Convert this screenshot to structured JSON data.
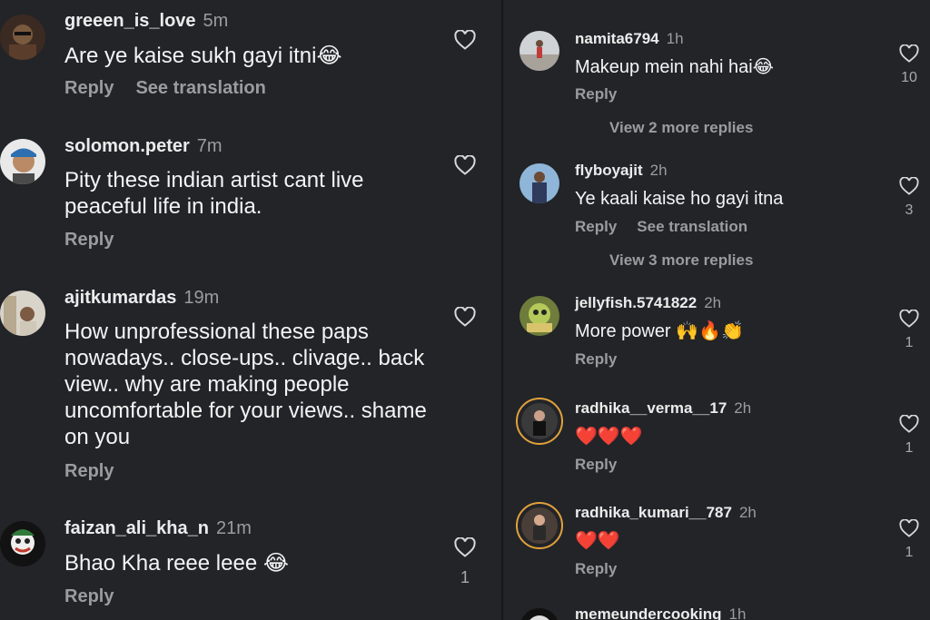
{
  "left_comments": [
    {
      "username": "greeen_is_love",
      "time": "5m",
      "text": "Are ye kaise sukh gayi itni😂",
      "reply": "Reply",
      "translate": "See translation",
      "likes": ""
    },
    {
      "username": "solomon.peter",
      "time": "7m",
      "text": "Pity these indian artist cant live peaceful life in india.",
      "reply": "Reply",
      "translate": "",
      "likes": ""
    },
    {
      "username": "ajitkumardas",
      "time": "19m",
      "text": "How unprofessional these paps nowadays.. close-ups.. clivage.. back view.. why are making people uncomfortable for your views.. shame on you",
      "reply": "Reply",
      "translate": "",
      "likes": ""
    },
    {
      "username": "faizan_ali_kha_n",
      "time": "21m",
      "text": "Bhao Kha reee leee 😂",
      "reply": "Reply",
      "translate": "",
      "likes": "1"
    }
  ],
  "right_comments": [
    {
      "username": "namita6794",
      "time": "1h",
      "text": "Makeup mein nahi hai😂",
      "reply": "Reply",
      "translate": "",
      "likes": "10",
      "more_replies": "View 2 more replies"
    },
    {
      "username": "flyboyajit",
      "time": "2h",
      "text": "Ye kaali kaise ho gayi itna",
      "reply": "Reply",
      "translate": "See translation",
      "likes": "3",
      "more_replies": "View 3 more replies"
    },
    {
      "username": "jellyfish.5741822",
      "time": "2h",
      "text": "More power 🙌🔥👏",
      "reply": "Reply",
      "translate": "",
      "likes": "1",
      "more_replies": ""
    },
    {
      "username": "radhika__verma__17",
      "time": "2h",
      "text": "❤️❤️❤️",
      "reply": "Reply",
      "translate": "",
      "likes": "1",
      "more_replies": ""
    },
    {
      "username": "radhika_kumari__787",
      "time": "2h",
      "text": "❤️❤️",
      "reply": "Reply",
      "translate": "",
      "likes": "1",
      "more_replies": ""
    },
    {
      "username": "memeundercooking",
      "time": "1h",
      "text": "",
      "reply": "",
      "translate": "",
      "likes": "",
      "more_replies": ""
    }
  ],
  "colors": {
    "background": "#222428",
    "muted": "#9a9ca0",
    "story_ring": "#e0a13b"
  },
  "icons": {
    "like": "heart-outline-icon"
  }
}
